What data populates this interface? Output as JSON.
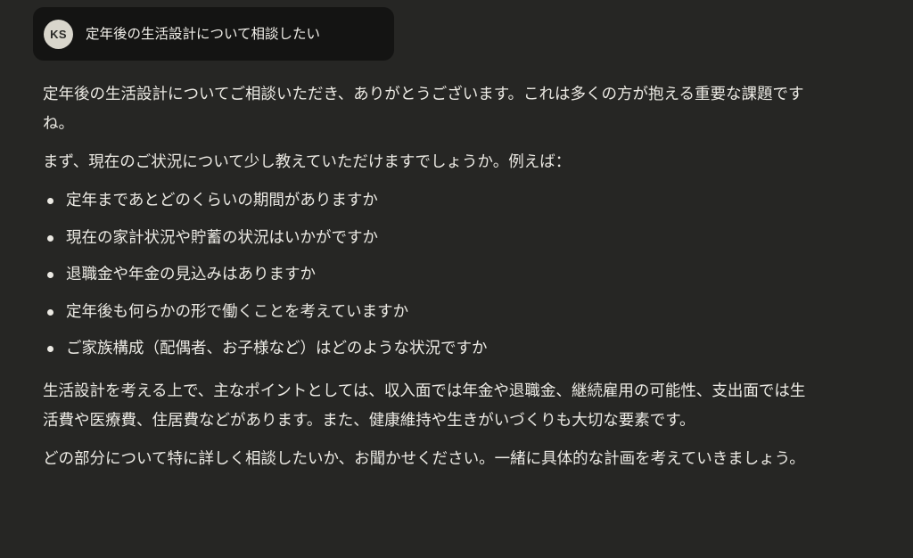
{
  "user_message": {
    "avatar_initials": "KS",
    "text": "定年後の生活設計について相談したい"
  },
  "assistant_response": {
    "intro": "定年後の生活設計についてご相談いただき、ありがとうございます。これは多くの方が抱える重要な課題ですね。",
    "question_lead": "まず、現在のご状況について少し教えていただけますでしょうか。例えば：",
    "questions": [
      "定年まであとどのくらいの期間がありますか",
      "現在の家計状況や貯蓄の状況はいかがですか",
      "退職金や年金の見込みはありますか",
      "定年後も何らかの形で働くことを考えていますか",
      "ご家族構成（配偶者、お子様など）はどのような状況ですか"
    ],
    "key_points": "生活設計を考える上で、主なポイントとしては、収入面では年金や退職金、継続雇用の可能性、支出面では生活費や医療費、住居費などがあります。また、健康維持や生きがいづくりも大切な要素です。",
    "closing": "どの部分について特に詳しく相談したいか、お聞かせください。一緒に具体的な計画を考えていきましょう。"
  },
  "colors": {
    "background": "#262624",
    "user_bubble": "#141413",
    "avatar": "#d9d6cc",
    "text": "#ebe9e3"
  }
}
